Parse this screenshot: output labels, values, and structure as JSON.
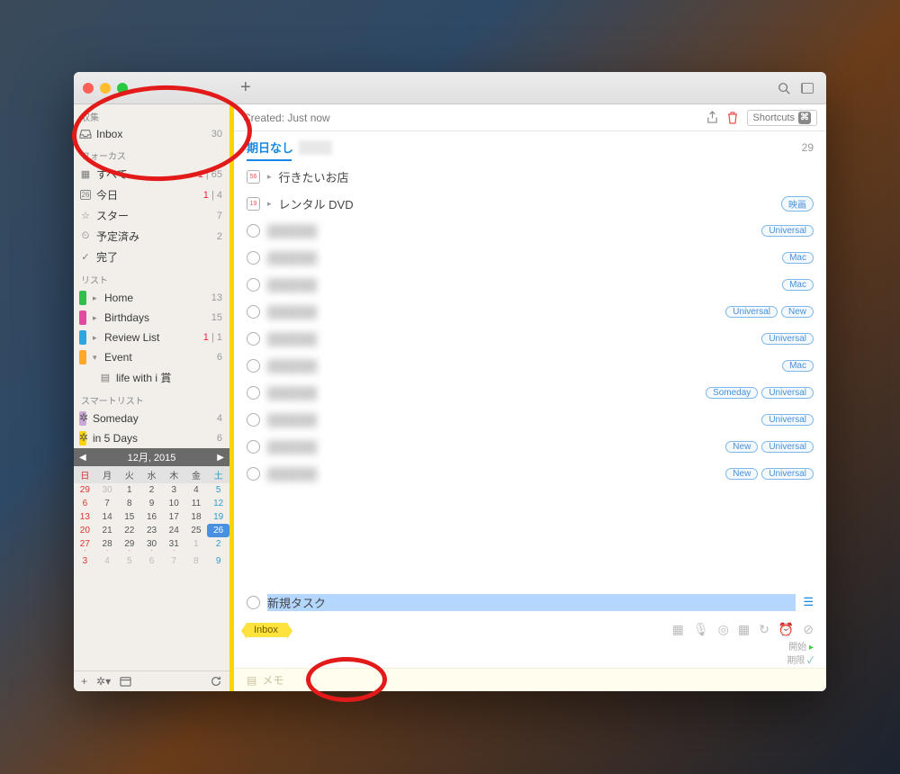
{
  "toolbar": {
    "created": "Created: Just now",
    "shortcuts": "Shortcuts"
  },
  "sidebar": {
    "groups": {
      "collect": "収集",
      "focus": "フォーカス",
      "lists": "リスト",
      "smart": "スマートリスト"
    },
    "inbox": {
      "label": "Inbox",
      "count": "30"
    },
    "focus": [
      {
        "label": "すべて",
        "count": "65",
        "red": "1"
      },
      {
        "label": "今日",
        "count": "4",
        "red": "1"
      },
      {
        "label": "スター",
        "count": "7"
      },
      {
        "label": "予定済み",
        "count": "2"
      },
      {
        "label": "完了"
      }
    ],
    "lists": [
      {
        "label": "Home",
        "count": "13",
        "color": "#2fbf4a"
      },
      {
        "label": "Birthdays",
        "count": "15",
        "color": "#e24aa1"
      },
      {
        "label": "Review List",
        "count": "1",
        "red": "1",
        "color": "#2ea7e0"
      },
      {
        "label": "Event",
        "count": "6",
        "color": "#ffa726",
        "expand": true
      },
      {
        "label": "life with i 賞",
        "sub": true
      }
    ],
    "smart": [
      {
        "label": "Someday",
        "count": "4",
        "color": "#c9a8d8"
      },
      {
        "label": "in 5 Days",
        "count": "6",
        "color": "#ffd400"
      }
    ]
  },
  "calendar": {
    "title": "12月, 2015",
    "dh": [
      "日",
      "月",
      "火",
      "水",
      "木",
      "金",
      "土"
    ],
    "rows": [
      [
        "29",
        "30",
        "1",
        "2",
        "3",
        "4",
        "5"
      ],
      [
        "6",
        "7",
        "8",
        "9",
        "10",
        "11",
        "12"
      ],
      [
        "13",
        "14",
        "15",
        "16",
        "17",
        "18",
        "19"
      ],
      [
        "20",
        "21",
        "22",
        "23",
        "24",
        "25",
        "26"
      ],
      [
        "27",
        "28",
        "29",
        "30",
        "31",
        "1",
        "2"
      ],
      [
        "3",
        "4",
        "5",
        "6",
        "7",
        "8",
        "9"
      ]
    ],
    "today": "26",
    "dimStart0": 2,
    "dimStart4": 5
  },
  "main": {
    "section": "期日なし",
    "section_count": "29",
    "tasks": [
      {
        "type": "date56",
        "title": "行きたいお店",
        "disc": true
      },
      {
        "type": "date19",
        "title": "レンタル DVD",
        "disc": true,
        "tags": [
          "映画"
        ]
      },
      {
        "type": "circle",
        "blur": true,
        "tags": [
          "Universal"
        ]
      },
      {
        "type": "circle",
        "blur": true,
        "tags": [
          "Mac"
        ]
      },
      {
        "type": "circle",
        "blur": true,
        "tags": [
          "Mac"
        ]
      },
      {
        "type": "circle",
        "blur": true,
        "tags": [
          "Universal",
          "New"
        ]
      },
      {
        "type": "circle",
        "blur": true,
        "tags": [
          "Universal"
        ]
      },
      {
        "type": "circle",
        "blur": true,
        "tags": [
          "Mac"
        ]
      },
      {
        "type": "circle",
        "blur": true,
        "tags": [
          "Someday",
          "Universal"
        ]
      },
      {
        "type": "circle",
        "blur": true,
        "tags": [
          "Universal"
        ]
      },
      {
        "type": "circle",
        "blur": true,
        "tags": [
          "New",
          "Universal"
        ]
      },
      {
        "type": "circle",
        "blur": true,
        "tags": [
          "New",
          "Universal"
        ]
      }
    ],
    "new_task": "新規タスク",
    "inbox_tag": "Inbox",
    "start": "開始",
    "due": "期限",
    "memo": "メモ"
  }
}
